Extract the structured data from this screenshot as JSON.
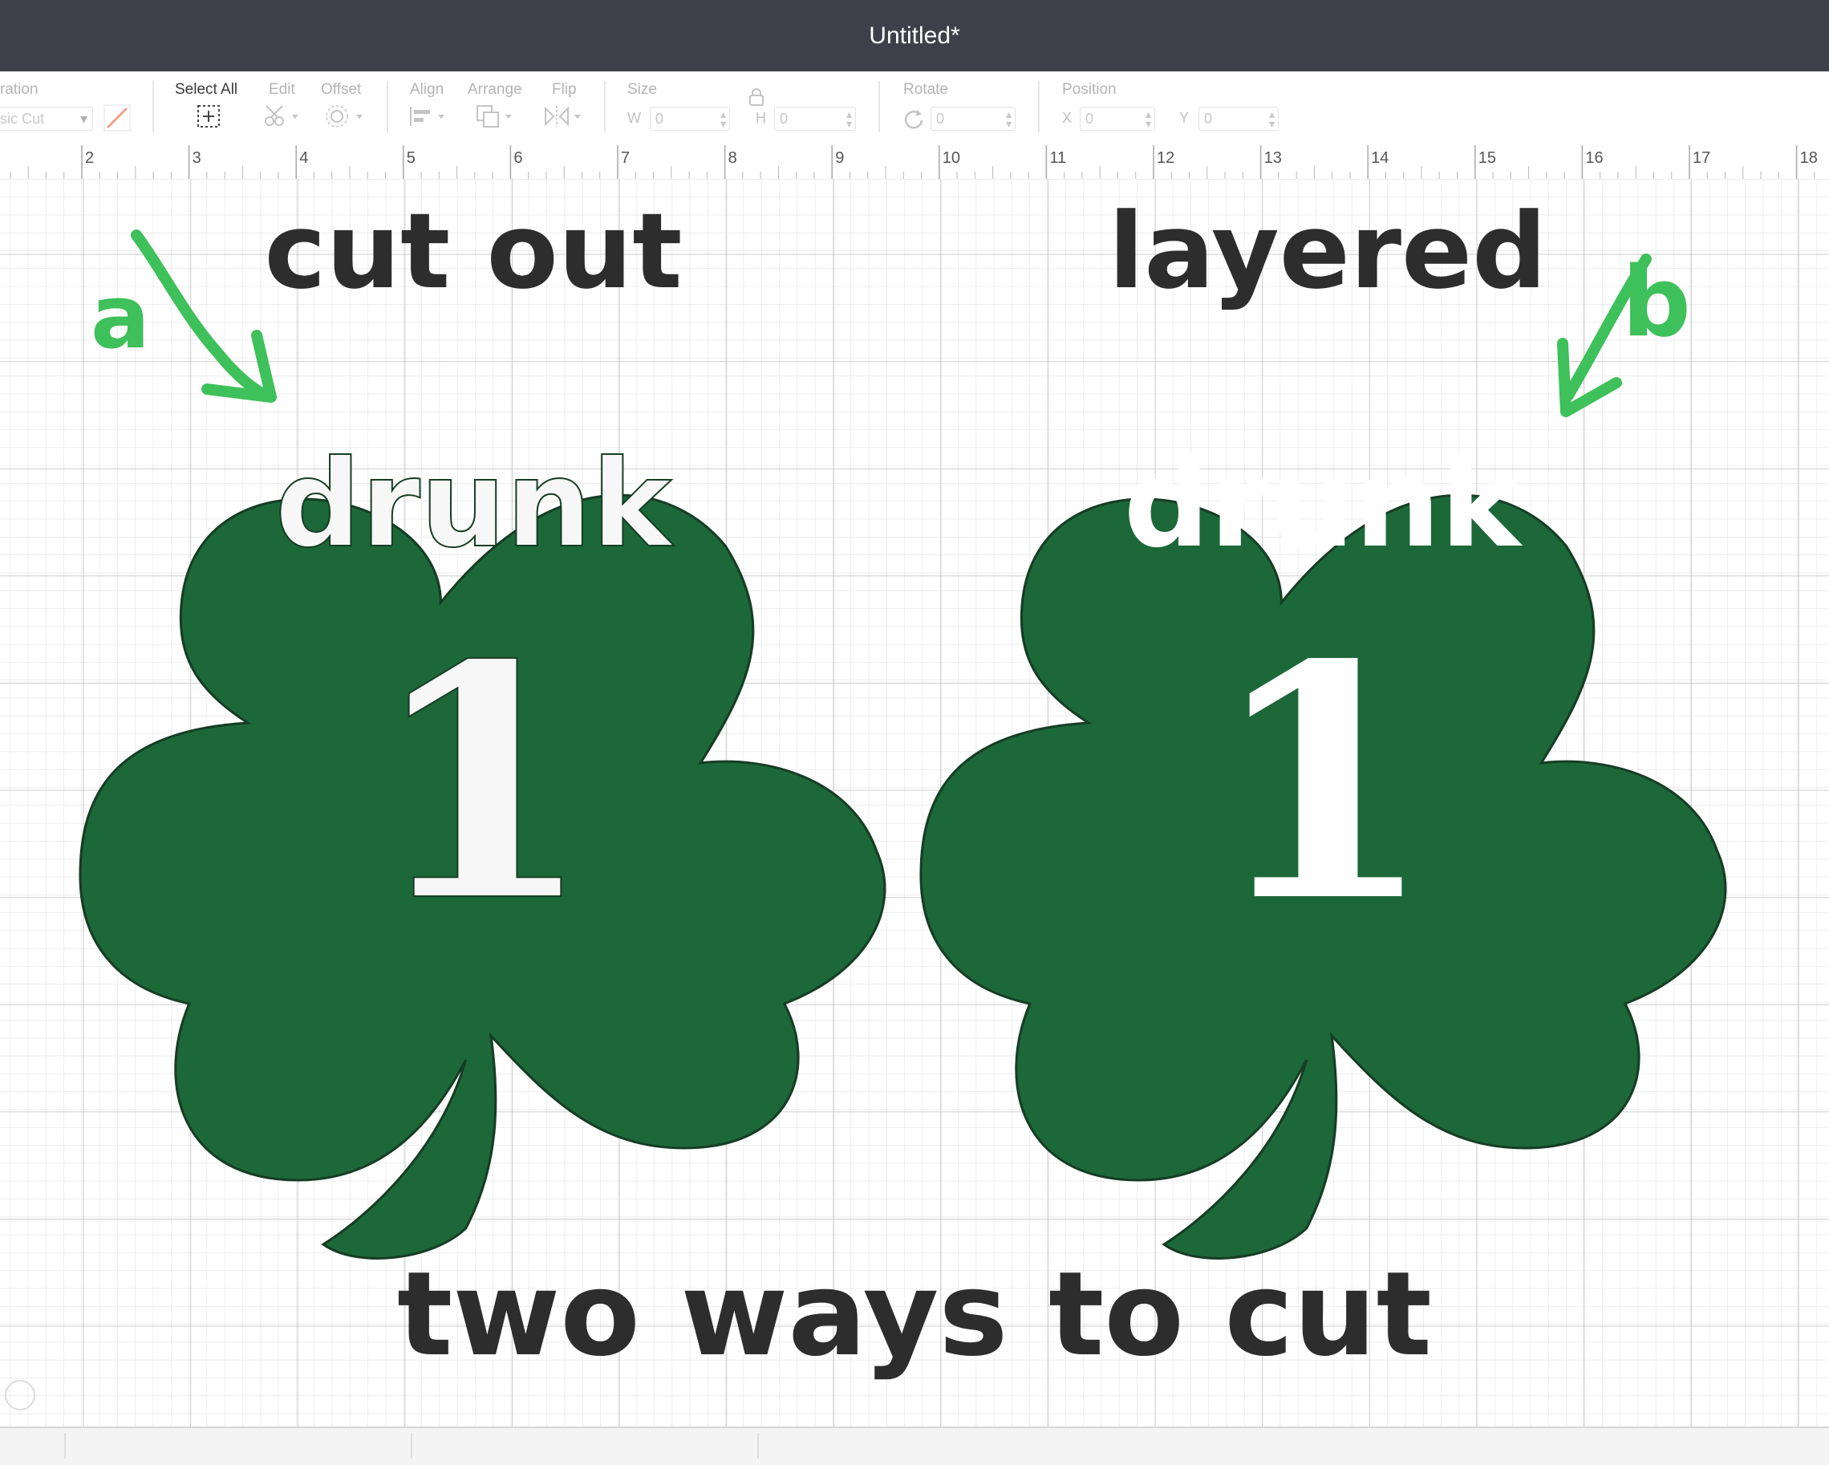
{
  "window": {
    "title": "Untitled*"
  },
  "toolbar": {
    "operation": {
      "label": "ration",
      "value": "sic Cut"
    },
    "select_all": {
      "label": "Select All"
    },
    "edit": {
      "label": "Edit"
    },
    "offset": {
      "label": "Offset"
    },
    "align": {
      "label": "Align"
    },
    "arrange": {
      "label": "Arrange"
    },
    "flip": {
      "label": "Flip"
    },
    "size": {
      "label": "Size",
      "w_prefix": "W",
      "w_value": "0",
      "h_prefix": "H",
      "h_value": "0"
    },
    "rotate": {
      "label": "Rotate",
      "value": "0"
    },
    "position": {
      "label": "Position",
      "x_prefix": "X",
      "x_value": "0",
      "y_prefix": "Y",
      "y_value": "0"
    }
  },
  "ruler": {
    "ticks": [
      "2",
      "3",
      "4",
      "5",
      "6",
      "7",
      "8",
      "9",
      "10",
      "11",
      "12",
      "13",
      "14",
      "15",
      "16",
      "17",
      "18"
    ]
  },
  "canvas": {
    "heading_left": "cut out",
    "heading_right": "layered",
    "annotation_left": "a",
    "annotation_right": "b",
    "left_design": {
      "word": "drunk",
      "number": "1"
    },
    "right_design": {
      "word": "drunk",
      "number": "1"
    },
    "footer": "two ways to cut"
  },
  "colors": {
    "titlebar": "#3d4048",
    "shamrock_green": "#1c6839",
    "annotation_green": "#3ec05a",
    "handwriting": "#2d2d2d",
    "grid_minor": "#e3e3e3",
    "grid_major": "#c6c6c6"
  }
}
